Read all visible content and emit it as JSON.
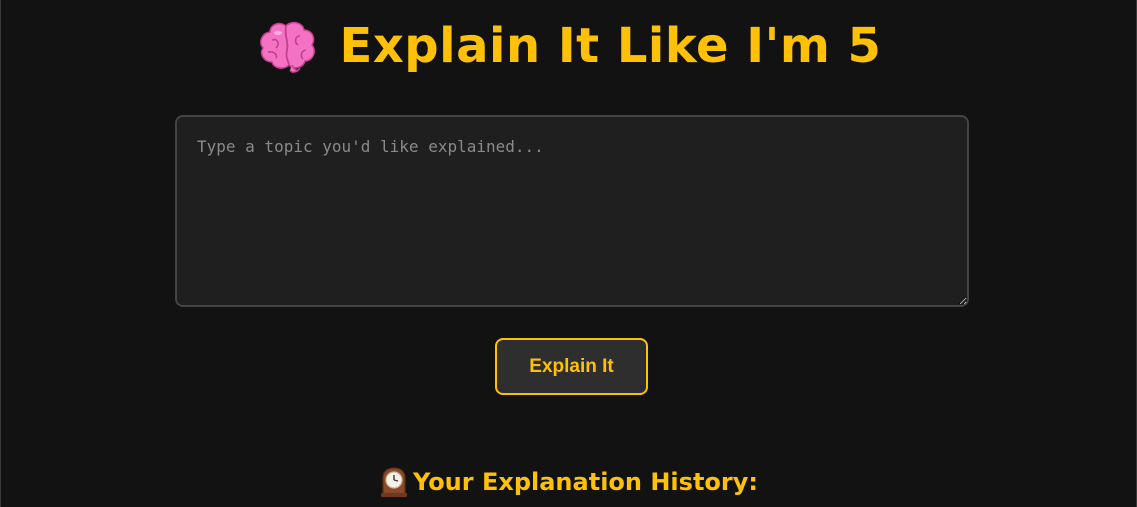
{
  "header": {
    "icon": "brain-icon",
    "title": "Explain It Like I'm 5"
  },
  "topic_input": {
    "placeholder": "Type a topic you'd like explained...",
    "value": ""
  },
  "explain_button": {
    "label": "Explain It"
  },
  "history": {
    "icon": "mantelpiece-clock-icon",
    "title": "Your Explanation History:"
  },
  "colors": {
    "background": "#121212",
    "accent": "#ffc107",
    "input_background": "#1f1f1f",
    "button_background": "#2e2e2e"
  }
}
